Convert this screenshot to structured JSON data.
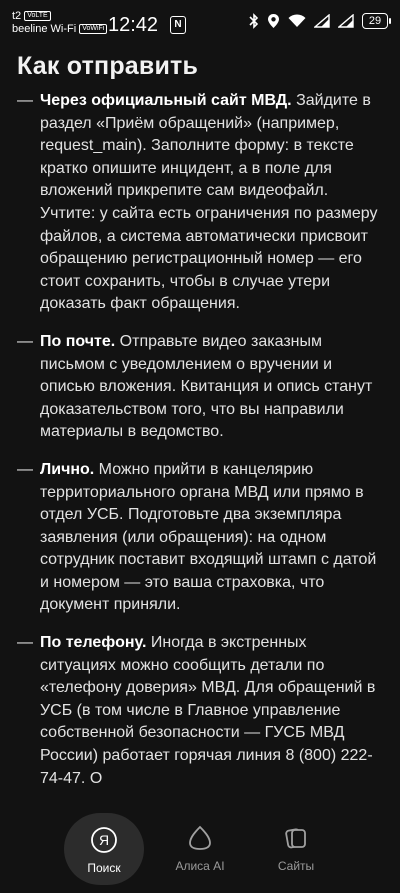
{
  "status_bar": {
    "carrier_top": "t2",
    "carrier_top_tag": "VoLTE",
    "carrier_bottom": "beeline Wi-Fi",
    "carrier_bottom_tag": "VoWiFi",
    "time": "12:42",
    "nfc": "N",
    "battery": "29"
  },
  "article": {
    "heading": "Как отправить",
    "items": [
      {
        "title": "Через официальный сайт МВД.",
        "text": " Зайдите в раздел «Приём обращений» (например, request_main). Заполните форму: в тексте кратко опишите инцидент, а в поле для вложений прикрепите сам видеофайл. Учтите: у сайта есть ограничения по размеру файлов, а система автоматически присвоит обращению регистрационный номер — его стоит сохранить, чтобы в случае утери доказать факт обращения."
      },
      {
        "title": "По почте.",
        "text": " Отправьте видео заказным письмом с уведомлением о вручении и описью вложения. Квитанция и опись станут доказательством того, что вы направили материалы в ведомство."
      },
      {
        "title": "Лично.",
        "text": " Можно прийти в канцелярию территориального органа МВД или прямо в отдел УСБ. Подготовьте два экземпляра заявления (или обращения): на одном сотрудник поставит входящий штамп с датой и номером — это ваша страховка, что документ приняли."
      },
      {
        "title": "По телефону.",
        "text": " Иногда в экстренных ситуациях можно сообщить детали по «телефону доверия» МВД. Для обращений в УСБ (в том числе в Главное управление собственной безопасности — ГУСБ МВД России) работает горячая линия 8 (800) 222-74-47. О"
      }
    ]
  },
  "bottom_nav": {
    "search": "Поиск",
    "alice": "Алиса AI",
    "sites": "Сайты",
    "search_icon_letter": "Я"
  }
}
